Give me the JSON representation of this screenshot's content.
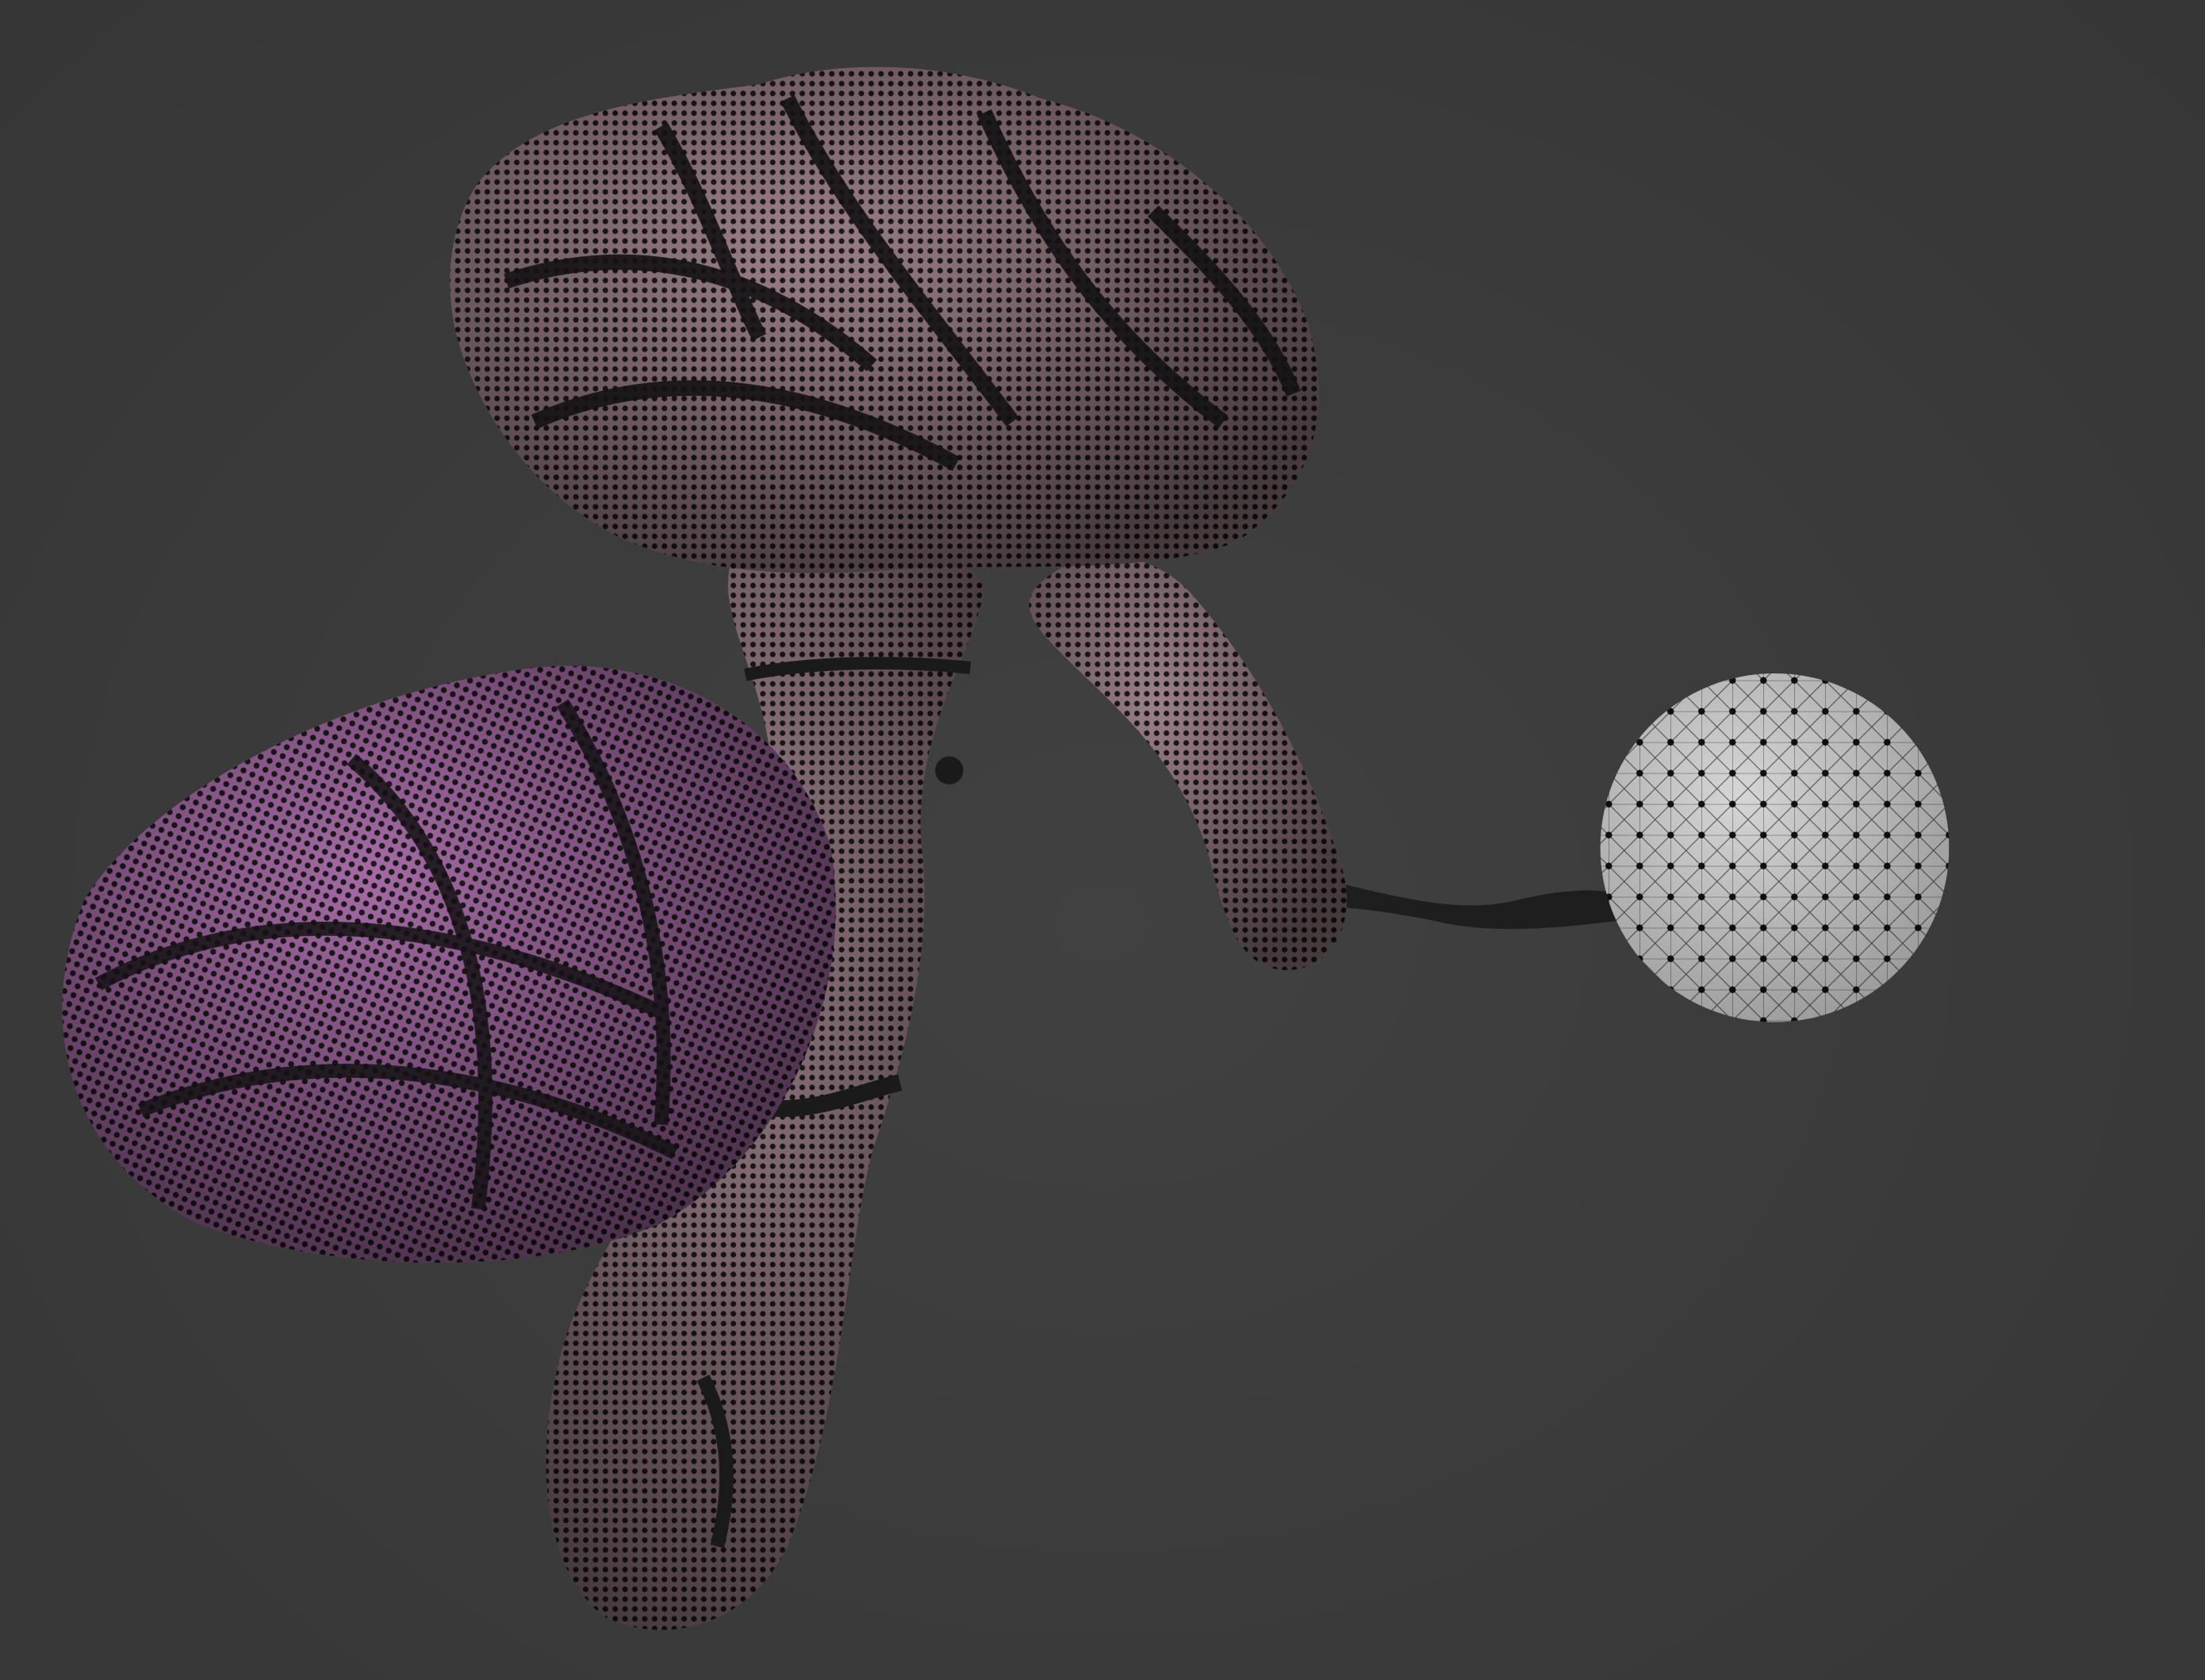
{
  "scene": {
    "background_color": "#3a3a3a",
    "mesh_color": "#9a7f86",
    "cerebellum_color": "#a86ca8",
    "dot_color": "#1c1a1c",
    "sphere_color": "#d8d8d8",
    "objects": [
      "cerebrum",
      "cerebellum",
      "brainstem",
      "optic-nerve",
      "eyeball-sphere"
    ]
  }
}
